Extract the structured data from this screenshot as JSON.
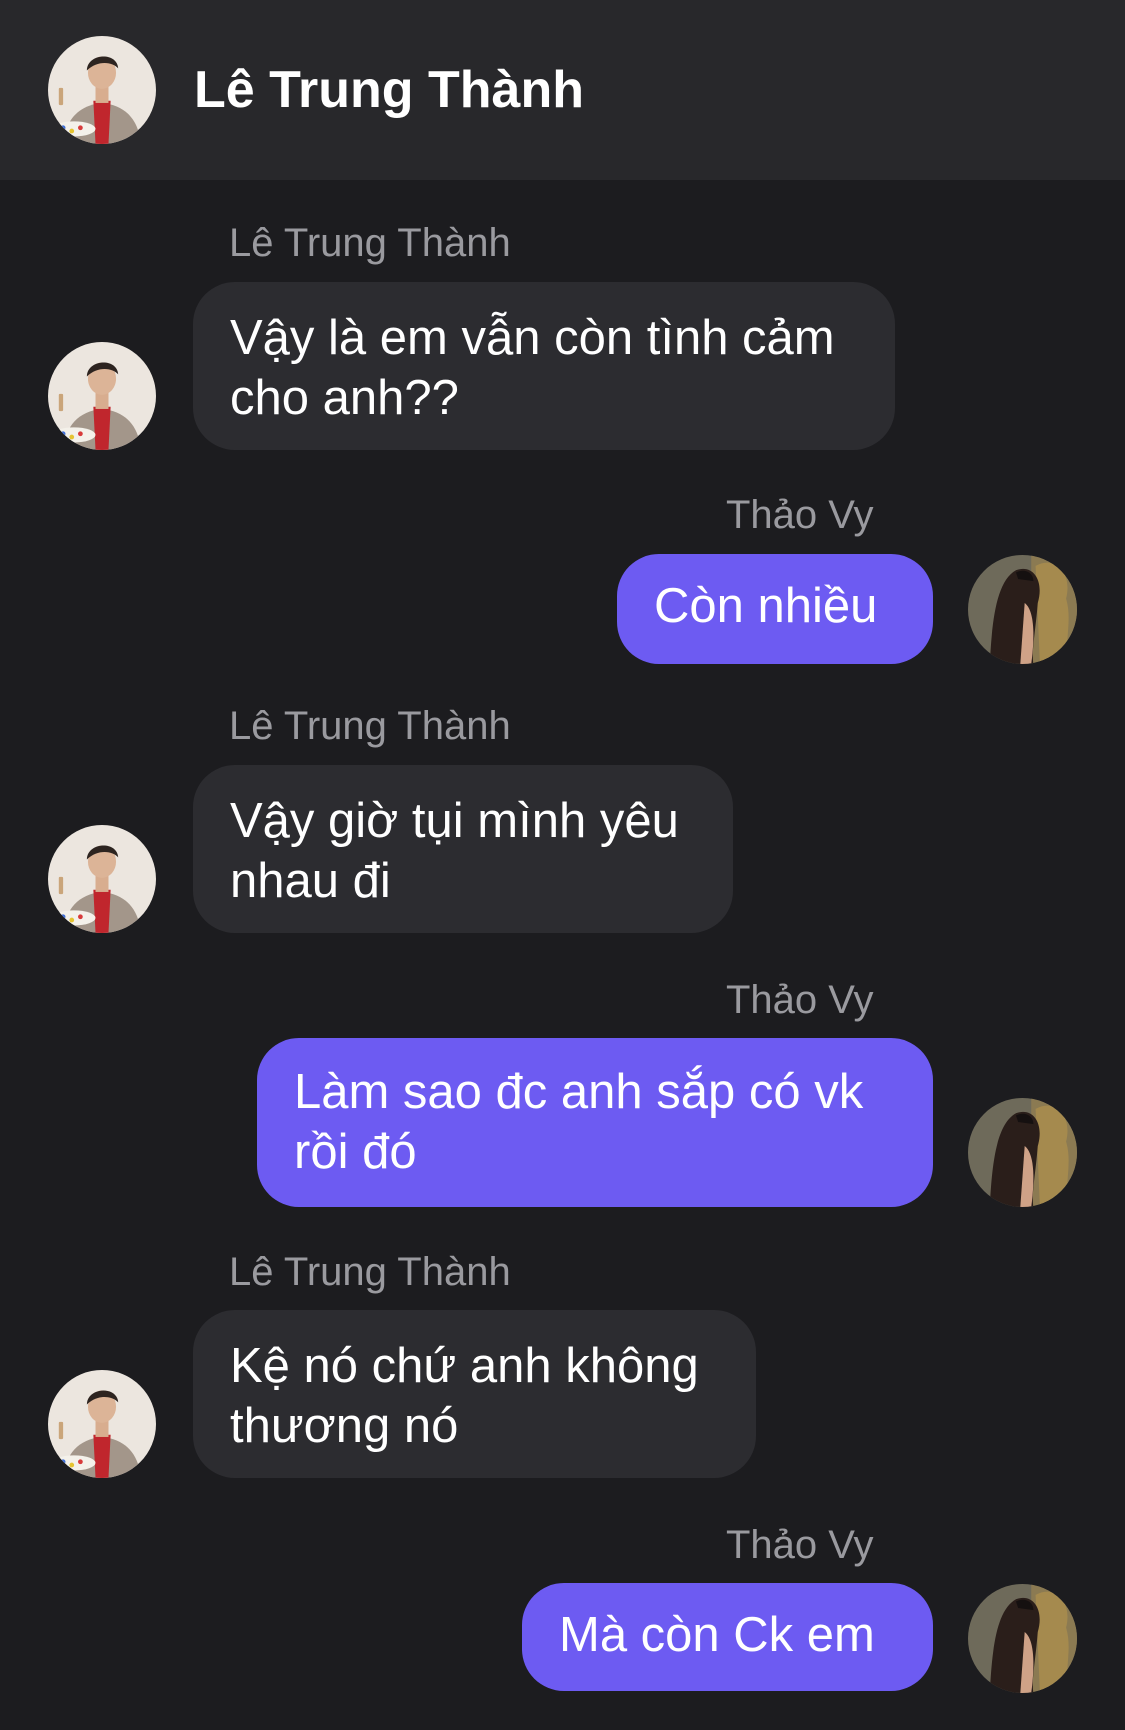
{
  "header": {
    "title": "Lê Trung Thành",
    "avatar_icon": "man-avatar-icon"
  },
  "colors": {
    "background": "#1c1c1f",
    "header": "#28282b",
    "incoming_bubble": "#2c2c30",
    "outgoing_bubble": "#6d5bf2",
    "sender_text": "#9a9a9f"
  },
  "messages": [
    {
      "direction": "incoming",
      "sender": "Lê Trung Thành",
      "text": "Vậy là em vẫn còn tình cảm cho anh??"
    },
    {
      "direction": "outgoing",
      "sender": "Thảo Vy",
      "text": "Còn nhiều"
    },
    {
      "direction": "incoming",
      "sender": "Lê Trung Thành",
      "text": "Vậy giờ tụi mình yêu nhau đi"
    },
    {
      "direction": "outgoing",
      "sender": "Thảo Vy",
      "text": "Làm sao đc anh sắp có vk rồi đó"
    },
    {
      "direction": "incoming",
      "sender": "Lê Trung Thành",
      "text": "Kệ nó chứ anh không thương nó"
    },
    {
      "direction": "outgoing",
      "sender": "Thảo Vy",
      "text": "Mà còn Ck em"
    }
  ]
}
